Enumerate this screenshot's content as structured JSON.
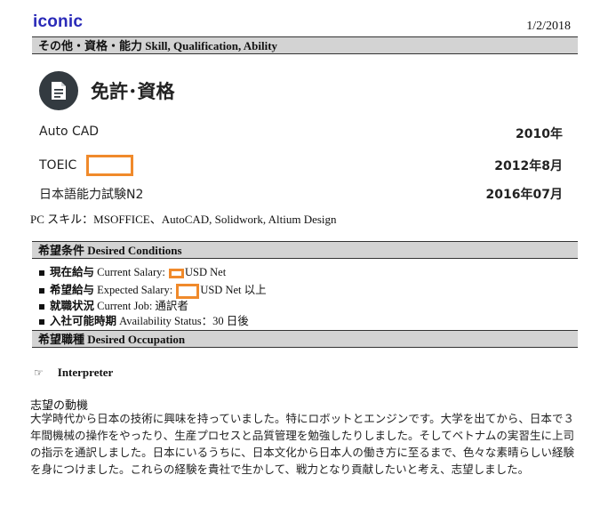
{
  "header": {
    "logo": "iconic",
    "date": "1/2/2018"
  },
  "sections": {
    "other": "その他・資格・能力 Skill, Qualification, Ability",
    "conditions": "希望条件 Desired Conditions",
    "occupation": "希望職種 Desired Occupation"
  },
  "licenses": {
    "title": "免許･資格",
    "icon": "document-icon",
    "items": [
      {
        "name": "Auto CAD",
        "year": "2010年"
      },
      {
        "name": "TOEIC",
        "year": "2012年8月"
      },
      {
        "name": "日本語能力試験N2",
        "year": "2016年07月"
      }
    ]
  },
  "pc_skills": "PC スキル：MSOFFICE、AutoCAD, Solidwork, Altium Design",
  "conditions": {
    "current_salary_label_jp": "現在給与",
    "current_salary_label_en": "Current Salary:",
    "current_salary_value": "USD Net",
    "expected_salary_label_jp": "希望給与",
    "expected_salary_label_en": "Expected Salary:",
    "expected_salary_value": "USD Net 以上",
    "current_job_label_jp": "就職状況",
    "current_job_label_en": "Current Job:",
    "current_job_value": "通訳者",
    "availability_label_jp": "入社可能時期",
    "availability_label_en": "Availability Status：",
    "availability_value": "30 日後"
  },
  "occupation": {
    "bullet": "☞",
    "value": "Interpreter"
  },
  "motive": {
    "title": "志望の動機",
    "body": "大学時代から日本の技術に興味を持っていました。特にロボットとエンジンです。大学を出てから、日本で３年間機械の操作をやったり、生産プロセスと品質管理を勉強したりしました。そしてベトナムの実習生に上司の指示を通訳しました。日本にいるうちに、日本文化から日本人の働き方に至るまで、色々な素晴らしい経験を身につけました。これらの経験を貴社で生かして、戦力となり貢献したいと考え、志望しました。"
  },
  "colors": {
    "logo": "#2a2ab8",
    "section_bar": "#d3d3d3",
    "redaction": "#f08a2b",
    "icon_circle": "#333a40"
  }
}
